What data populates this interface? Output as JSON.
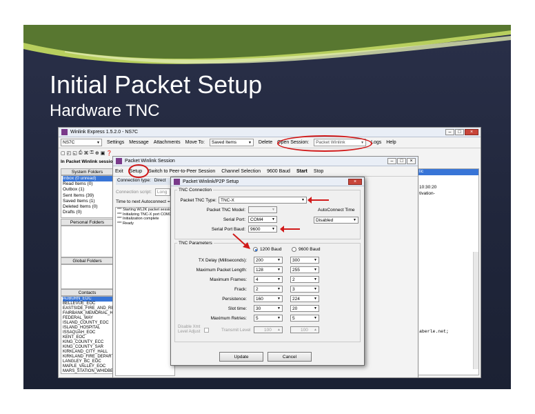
{
  "slide": {
    "title": "Initial Packet Setup",
    "subtitle": "Hardware TNC"
  },
  "main_window": {
    "title": "Winlink Express 1.5.2.0 - NS7C",
    "callsign": "NS7C",
    "menu": [
      "Settings",
      "Message",
      "Attachments",
      "Move To:",
      "Delete",
      "Logs",
      "Help"
    ],
    "move_to_value": "Saved Items",
    "open_session_label": "Open Session:",
    "open_session_value": "Packet Winlink",
    "session_label": "In Packet Winlink sessio",
    "system_folders_header": "System Folders",
    "system_folders": [
      "Inbox (0 unread)",
      "Read Items (0)",
      "Outbox (1)",
      "Sent Items (39)",
      "Saved Items (1)",
      "Deleted Items (0)",
      "Drafts (0)"
    ],
    "personal_folders_header": "Personal Folders",
    "global_folders_header": "Global Folders",
    "contacts_header": "Contacts",
    "contacts": [
      "AUBURN_EOC",
      "BELLEVUE_EOC",
      "EASTSIDE_FIRE_AND_RE",
      "FAIRBANK_MEMORIAL_HC",
      "FEDERAL_WAY",
      "ISLAND_COUNTY_EOC",
      "ISLAND_HOSPITAL",
      "ISSAQUAH_EOC",
      "KENT_EOC",
      "KING_COUNTY_ECC",
      "KING_COUNTY_SAR",
      "KIRKLAND_CITY_HALL",
      "KIRKLAND_FIRE_DEPARTI",
      "LANGLEY_BC_EOC",
      "MAPLE_VALLEY_EOC",
      "MARS_STATION_WHIDBE"
    ],
    "right_col": [
      "lic",
      "10:30:20",
      "tivation-"
    ],
    "right_email": "aberle.net;"
  },
  "session_window": {
    "title": "Packet Winlink Session",
    "menu": [
      "Exit",
      "Setup",
      "Switch to Peer-to-Peer Session",
      "Channel Selection",
      "9600 Baud",
      "Start",
      "Stop"
    ],
    "connection_type_label": "Connection type:",
    "connection_type_value": "Direct",
    "connection_script_label": "Connection script:",
    "connection_script_value": "Long",
    "autoconnect_text": "Time to next Autoconnect = D",
    "log": [
      "*** Starting WL2K packet session",
      "*** Initializing TNC-X port COM3",
      "*** Initialization complete",
      "*** Ready"
    ]
  },
  "dialog": {
    "title": "Packet Winlink/P2P Setup",
    "tnc_connection_group": "TNC Connection",
    "tnc_type_label": "Packet TNC Type:",
    "tnc_type_value": "TNC-X",
    "tnc_model_label": "Packet TNC Model:",
    "tnc_model_value": "",
    "serial_port_label": "Serial Port:",
    "serial_port_value": "COM4",
    "serial_baud_label": "Serial Port Baud:",
    "serial_baud_value": "9600",
    "autoconnect_label": "AutoConnect Time",
    "autoconnect_value": "Disabled",
    "tnc_parameters_group": "TNC Parameters",
    "baud_1200": "1200 Baud",
    "baud_9600": "9600 Baud",
    "params": [
      {
        "label": "TX Delay (Milliseconds):",
        "v1200": "200",
        "v9600": "300"
      },
      {
        "label": "Maximum Packet Length:",
        "v1200": "128",
        "v9600": "255"
      },
      {
        "label": "Maximum Frames:",
        "v1200": "4",
        "v9600": "2"
      },
      {
        "label": "Frack:",
        "v1200": "2",
        "v9600": "3"
      },
      {
        "label": "Persistence:",
        "v1200": "160",
        "v9600": "224"
      },
      {
        "label": "Slot time:",
        "v1200": "30",
        "v9600": "20"
      },
      {
        "label": "Maximum Retries:",
        "v1200": "5",
        "v9600": "5"
      }
    ],
    "disable_xmit_label": "Disable Xmt Level Adjust",
    "transmit_level_label": "Transmit Level",
    "transmit_level_1200": "100",
    "transmit_level_9600": "100",
    "update_button": "Update",
    "cancel_button": "Cancel"
  },
  "colors": {
    "accent_red": "#d11a1a",
    "selection": "#3875d7",
    "slide_bg": "#232a40"
  }
}
